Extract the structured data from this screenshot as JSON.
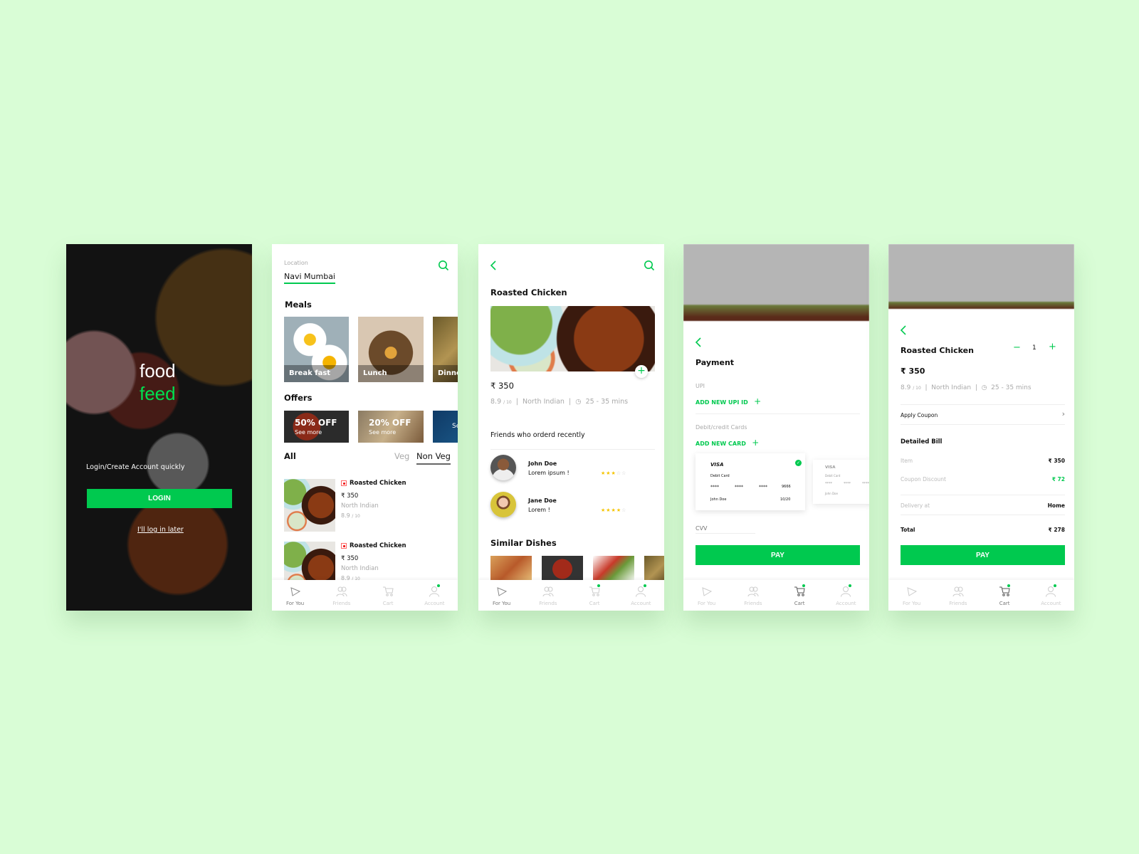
{
  "colors": {
    "accent": "#00c94f",
    "background": "#d9fdd6",
    "rating_star": "#f5c400"
  },
  "nav": [
    "For You",
    "Friends",
    "Cart",
    "Account"
  ],
  "login": {
    "brand_line1": "food",
    "brand_line2": "feed",
    "prompt": "Login/Create Account quickly",
    "login_button": "LOGIN",
    "later_link": "I'll log in later"
  },
  "home": {
    "location_label": "Location",
    "location_value": "Navi Mumbai",
    "meals_title": "Meals",
    "meals": [
      "Break fast",
      "Lunch",
      "Dinne"
    ],
    "offers_title": "Offers",
    "offers": [
      {
        "title": "50% OFF",
        "sub": "See more"
      },
      {
        "title": "20% OFF",
        "sub": "See more"
      },
      {
        "title": "",
        "sub": "Se"
      }
    ],
    "filter_all": "All",
    "filter_veg": "Veg",
    "filter_nonveg": "Non Veg",
    "items": [
      {
        "name": "Roasted Chicken",
        "price": "₹ 350",
        "cuisine": "North Indian",
        "rating": "8.9",
        "rating_max": "/ 10"
      },
      {
        "name": "Roasted Chicken",
        "price": "₹ 350",
        "cuisine": "North Indian",
        "rating": "8.9",
        "rating_max": "/ 10"
      }
    ]
  },
  "detail": {
    "title": "Roasted Chicken",
    "price": "₹ 350",
    "rating": "8.9",
    "rating_max": "/ 10",
    "cuisine": "North Indian",
    "time": "25 - 35 mins",
    "friends_title": "Friends who orderd recently",
    "friends": [
      {
        "name": "John Doe",
        "comment": "Lorem ipsum !",
        "stars": 3
      },
      {
        "name": "Jane Doe",
        "comment": "Lorem !",
        "stars": 4
      }
    ],
    "similar_title": "Similar Dishes"
  },
  "payment": {
    "title": "Payment",
    "upi_label": "UPI",
    "add_upi": "ADD NEW UPI ID",
    "cards_label": "Debit/credit Cards",
    "add_card": "ADD NEW CARD",
    "cards": [
      {
        "brand": "VISA",
        "type": "Debit Card",
        "masked": [
          "****",
          "****",
          "****"
        ],
        "last4": "9666",
        "holder": "John Doe",
        "expiry": "10/20",
        "selected": true
      },
      {
        "brand": "VISA",
        "type": "Debit Card",
        "masked": [
          "****",
          "****",
          "****"
        ],
        "holder": "John Doe",
        "selected": false
      }
    ],
    "cvv_placeholder": "CVV",
    "pay_button": "PAY"
  },
  "cart": {
    "title": "Roasted Chicken",
    "quantity": "1",
    "price": "₹ 350",
    "rating": "8.9",
    "rating_max": "/ 10",
    "cuisine": "North Indian",
    "time": "25 - 35 mins",
    "apply_coupon": "Apply Coupon",
    "bill_title": "Detailed Bill",
    "item_label": "Item",
    "item_value": "₹ 350",
    "coupon_label": "Coupon Discount",
    "coupon_value": "₹ 72",
    "delivery_label": "Delivery at",
    "delivery_value": "Home",
    "total_label": "Total",
    "total_value": "₹ 278",
    "pay_button": "PAY"
  }
}
